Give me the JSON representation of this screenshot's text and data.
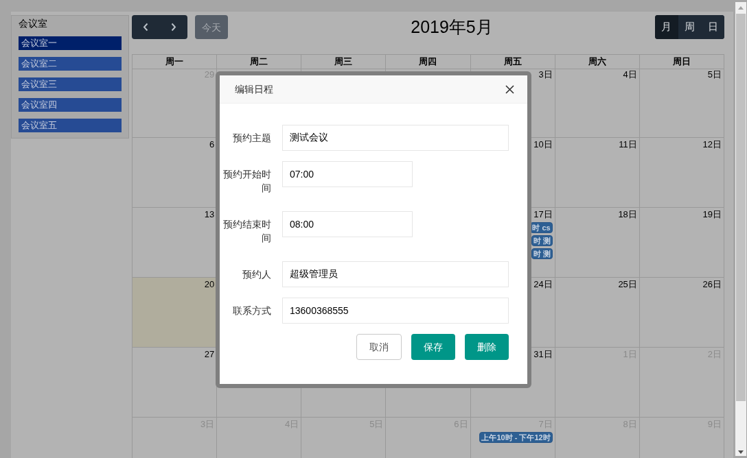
{
  "sidebar": {
    "title": "会议室",
    "rooms": [
      {
        "label": "会议室一",
        "selected": true
      },
      {
        "label": "会议室二",
        "selected": false
      },
      {
        "label": "会议室三",
        "selected": false
      },
      {
        "label": "会议室四",
        "selected": false
      },
      {
        "label": "会议室五",
        "selected": false
      }
    ]
  },
  "toolbar": {
    "today_button": {
      "label": "今天",
      "disabled": true
    },
    "title": "2019年5月",
    "views": [
      {
        "label": "月",
        "selected": true
      },
      {
        "label": "周",
        "selected": false
      },
      {
        "label": "日",
        "selected": false
      }
    ]
  },
  "calendar": {
    "weekdays": [
      "周一",
      "周二",
      "周三",
      "周四",
      "周五",
      "周六",
      "周日"
    ],
    "weeks": [
      {
        "start": [
          {
            "day": "29",
            "other_month": true,
            "today": false
          }
        ],
        "end": [
          {
            "day": "3日",
            "other_month": false,
            "today": false
          },
          {
            "day": "4日",
            "other_month": false,
            "today": false
          },
          {
            "day": "5日",
            "other_month": false,
            "today": false
          }
        ]
      },
      {
        "start": [
          {
            "day": "6",
            "other_month": false,
            "today": false
          }
        ],
        "end": [
          {
            "day": "10日",
            "other_month": false,
            "today": false
          },
          {
            "day": "11日",
            "other_month": false,
            "today": false
          },
          {
            "day": "12日",
            "other_month": false,
            "today": false
          }
        ]
      },
      {
        "start": [
          {
            "day": "13",
            "other_month": false,
            "today": false
          }
        ],
        "end": [
          {
            "day": "17日",
            "other_month": false,
            "today": false,
            "events": [
              "时 cs",
              "时 测",
              "时 测"
            ]
          },
          {
            "day": "18日",
            "other_month": false,
            "today": false
          },
          {
            "day": "19日",
            "other_month": false,
            "today": false
          }
        ]
      },
      {
        "start": [
          {
            "day": "20",
            "other_month": false,
            "today": true
          }
        ],
        "end": [
          {
            "day": "24日",
            "other_month": false,
            "today": false
          },
          {
            "day": "25日",
            "other_month": false,
            "today": false
          },
          {
            "day": "26日",
            "other_month": false,
            "today": false
          }
        ]
      },
      {
        "start": [
          {
            "day": "27",
            "other_month": false,
            "today": false
          }
        ],
        "end": [
          {
            "day": "31日",
            "other_month": false,
            "today": false
          },
          {
            "day": "1日",
            "other_month": true,
            "today": false
          },
          {
            "day": "2日",
            "other_month": true,
            "today": false
          }
        ]
      },
      {
        "start": [
          {
            "day": "3日",
            "other_month": true,
            "today": false
          },
          {
            "day": "4日",
            "other_month": true,
            "today": false
          },
          {
            "day": "5日",
            "other_month": true,
            "today": false
          },
          {
            "day": "6日",
            "other_month": true,
            "today": false
          },
          {
            "day": "7日",
            "other_month": true,
            "today": false,
            "events": [
              "上午10时 - 下午12时"
            ]
          },
          {
            "day": "8日",
            "other_month": true,
            "today": false
          },
          {
            "day": "9日",
            "other_month": true,
            "today": false
          }
        ]
      }
    ]
  },
  "dialog": {
    "title": "编辑日程",
    "fields": [
      {
        "label": "预约主题",
        "value": "测试会议",
        "kind": "wide"
      },
      {
        "label": "预约开始时间",
        "value": "07:00",
        "kind": "short"
      },
      {
        "label": "预约结束时间",
        "value": "08:00",
        "kind": "short"
      },
      {
        "label": "预约人",
        "value": "超级管理员",
        "kind": "wide"
      },
      {
        "label": "联系方式",
        "value": "13600368555",
        "kind": "wide"
      }
    ],
    "buttons": [
      {
        "label": "取消",
        "kind": "secondary"
      },
      {
        "label": "保存",
        "kind": "primary"
      },
      {
        "label": "删除",
        "kind": "primary"
      }
    ]
  }
}
